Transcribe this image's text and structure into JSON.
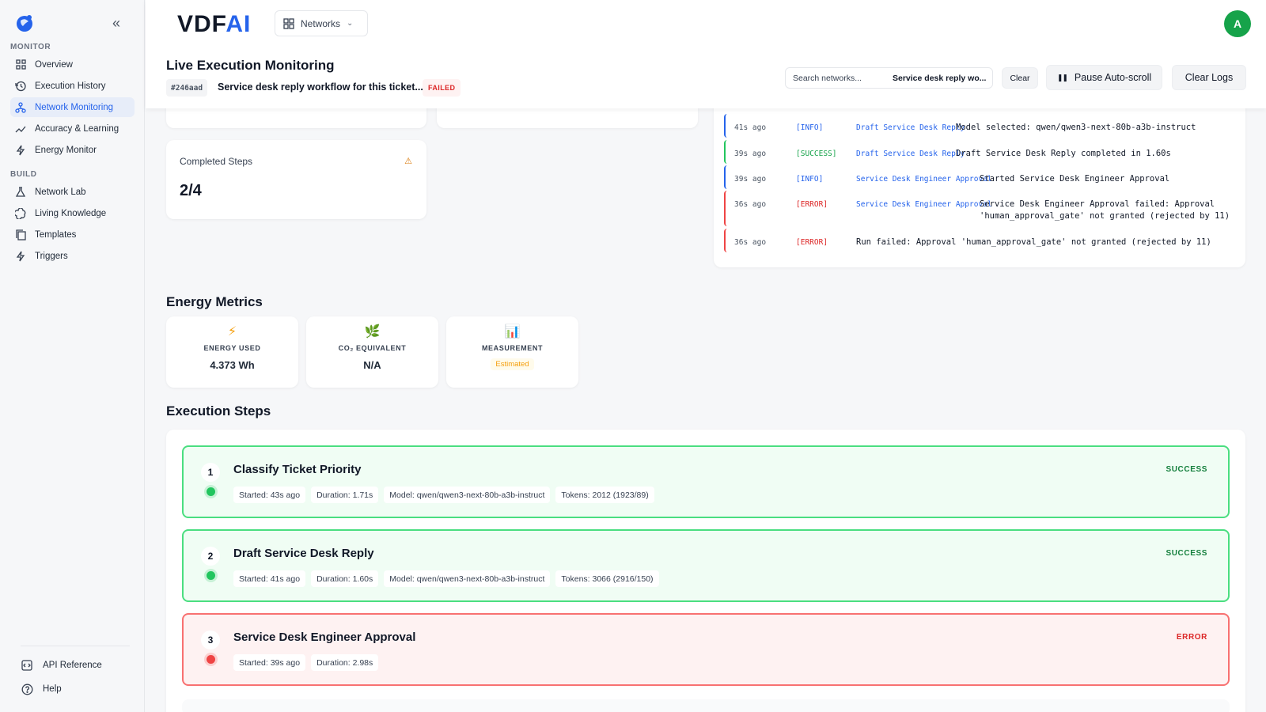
{
  "sidebar": {
    "sections": {
      "monitor": "MONITOR",
      "build": "BUILD"
    },
    "items": [
      {
        "label": "Overview",
        "icon": "grid-icon"
      },
      {
        "label": "Execution History",
        "icon": "history-icon"
      },
      {
        "label": "Network Monitoring",
        "icon": "network-icon",
        "active": true
      },
      {
        "label": "Accuracy & Learning",
        "icon": "trend-icon"
      },
      {
        "label": "Energy Monitor",
        "icon": "bolt-icon"
      },
      {
        "label": "Network Lab",
        "icon": "flask-icon"
      },
      {
        "label": "Living Knowledge",
        "icon": "brain-icon"
      },
      {
        "label": "Templates",
        "icon": "copy-icon"
      },
      {
        "label": "Triggers",
        "icon": "bolt-icon"
      }
    ],
    "footer": [
      {
        "label": "API Reference",
        "icon": "code-icon"
      },
      {
        "label": "Help",
        "icon": "help-icon"
      }
    ]
  },
  "header": {
    "brand": {
      "main": "VDF",
      "accent": "AI"
    },
    "networks_label": "Networks",
    "avatar_initial": "A",
    "title": "Live Execution Monitoring",
    "run_id": "#246aad",
    "run_desc": "Service desk reply workflow for this ticket...",
    "run_status": "FAILED",
    "search_placeholder": "Search networks...",
    "search_value": "Service desk reply wo...",
    "clear_label": "Clear",
    "pause_label": "Pause Auto-scroll",
    "clear_logs_label": "Clear Logs"
  },
  "completed_steps": {
    "label": "Completed Steps",
    "value": "2/4",
    "warning_icon": "⚠"
  },
  "logs": [
    {
      "time": "41s ago",
      "level": "[INFO]",
      "kind": "info",
      "step": "Draft Service Desk Reply",
      "message": "Model selected: qwen/qwen3-next-80b-a3b-instruct"
    },
    {
      "time": "39s ago",
      "level": "[SUCCESS]",
      "kind": "success",
      "step": "Draft Service Desk Reply",
      "message": "Draft Service Desk Reply completed in 1.60s"
    },
    {
      "time": "39s ago",
      "level": "[INFO]",
      "kind": "info",
      "step": "Service Desk Engineer Approval",
      "message": "Started Service Desk Engineer Approval"
    },
    {
      "time": "36s ago",
      "level": "[ERROR]",
      "kind": "error",
      "step": "Service Desk Engineer Approval",
      "message": "Service Desk Engineer Approval failed: Approval 'human_approval_gate' not granted (rejected by 11)"
    },
    {
      "time": "36s ago",
      "level": "[ERROR]",
      "kind": "error",
      "step": "",
      "message": "Run failed: Approval 'human_approval_gate' not granted (rejected by 11)"
    }
  ],
  "energy": {
    "title": "Energy Metrics",
    "metrics": [
      {
        "icon": "⚡",
        "label": "ENERGY USED",
        "value": "4.373 Wh"
      },
      {
        "icon": "🌿",
        "label": "CO₂ EQUIVALENT",
        "value": "N/A"
      },
      {
        "icon": "📊",
        "label": "MEASUREMENT",
        "value": "Estimated"
      }
    ]
  },
  "steps": {
    "title": "Execution Steps",
    "items": [
      {
        "num": "1",
        "name": "Classify Ticket Priority",
        "status": "SUCCESS",
        "started": "Started: 43s ago",
        "duration": "Duration: 1.71s",
        "model": "Model: qwen/qwen3-next-80b-a3b-instruct",
        "tokens": "Tokens: 2012 (1923/89)"
      },
      {
        "num": "2",
        "name": "Draft Service Desk Reply",
        "status": "SUCCESS",
        "started": "Started: 41s ago",
        "duration": "Duration: 1.60s",
        "model": "Model: qwen/qwen3-next-80b-a3b-instruct",
        "tokens": "Tokens: 3066 (2916/150)"
      },
      {
        "num": "3",
        "name": "Service Desk Engineer Approval",
        "status": "ERROR",
        "started": "Started: 39s ago",
        "duration": "Duration: 2.98s"
      }
    ]
  },
  "colors": {
    "accent": "#2563eb",
    "success": "#22c55e",
    "error": "#ef4444",
    "warning": "#f59e0b"
  }
}
